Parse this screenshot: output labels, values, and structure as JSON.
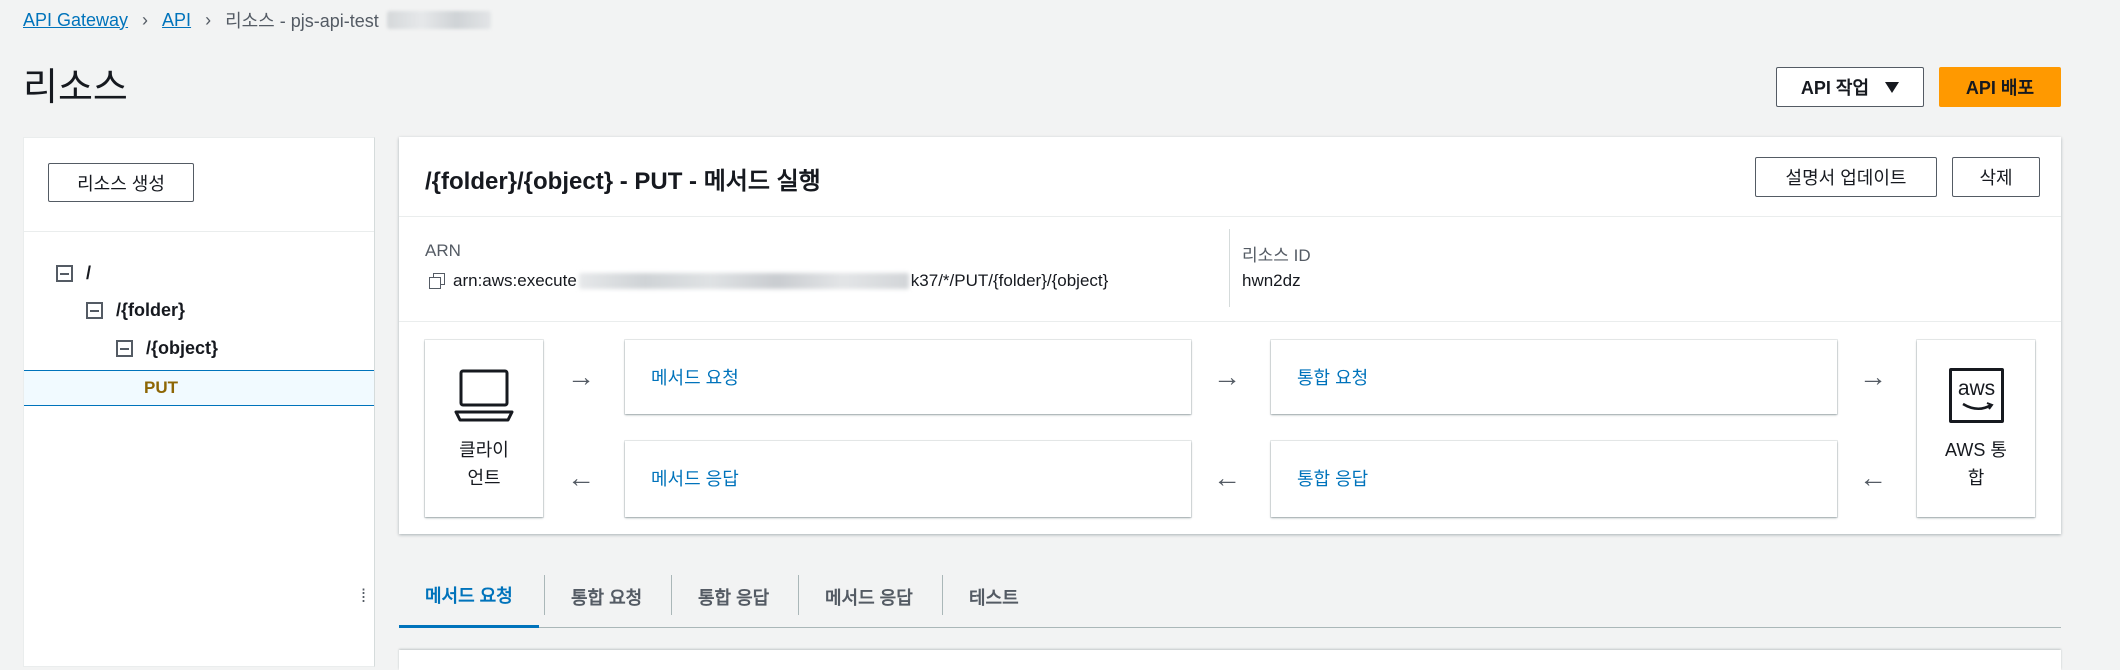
{
  "breadcrumb": {
    "items": [
      "API Gateway",
      "API"
    ],
    "current": "리소스 - pjs-api-test"
  },
  "page": {
    "title": "리소스",
    "actions_label": "API 작업",
    "deploy_label": "API 배포"
  },
  "left_panel": {
    "create_label": "리소스 생성",
    "tree": {
      "root": "/",
      "folder": "/{folder}",
      "object": "/{object}",
      "method": "PUT"
    }
  },
  "method_card": {
    "title": "/{folder}/{object} - PUT - 메서드 실행",
    "update_doc_label": "설명서 업데이트",
    "delete_label": "삭제",
    "arn_label": "ARN",
    "arn_prefix": "arn:aws:execute",
    "arn_suffix": "k37/*/PUT/{folder}/{object}",
    "resource_id_label": "리소스 ID",
    "resource_id": "hwn2dz"
  },
  "flow": {
    "client_label_1": "클라이",
    "client_label_2": "언트",
    "method_request": "메서드 요청",
    "integration_request": "통합 요청",
    "method_response": "메서드 응답",
    "integration_response": "통합 응답",
    "aws_logo": "aws",
    "aws_label_1": "AWS 통",
    "aws_label_2": "합"
  },
  "tabs": [
    "메서드 요청",
    "통합 요청",
    "통합 응답",
    "메서드 응답",
    "테스트"
  ],
  "icons": {
    "arrow_right": "→",
    "arrow_left": "←",
    "resize": "⁞"
  },
  "colors": {
    "link": "#0073bb",
    "primary": "#ff9900",
    "method_put": "#8d6605"
  }
}
